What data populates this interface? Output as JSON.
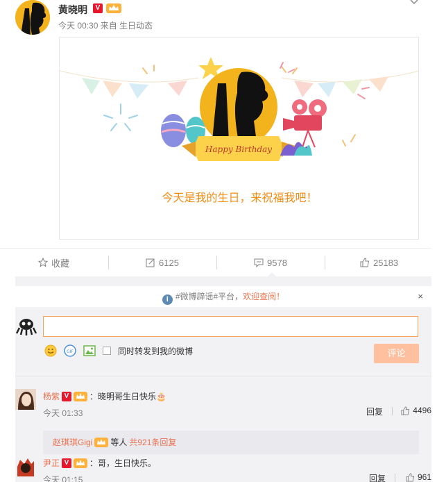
{
  "author": {
    "name": "黄晓明",
    "verified": "V",
    "meta": "今天 00:30 来自 生日动态"
  },
  "card": {
    "banner_text": "Happy Birthday",
    "message": "今天是我的生日，来祝福我吧！"
  },
  "actions": {
    "favorite": "收藏",
    "repost": "6125",
    "comment": "9578",
    "like": "25183"
  },
  "notice": {
    "prefix": "#微博辟谣#平台，",
    "link": "欢迎查阅！",
    "close": "×"
  },
  "composer": {
    "sync_label": "同时转发到我的微博",
    "post_button": "评论",
    "input_value": ""
  },
  "comments": [
    {
      "user": "杨紫",
      "verified": "V",
      "text": "：晓明哥生日快乐🎂",
      "time": "今天 01:33",
      "reply": "回复",
      "likes": "4496",
      "sub": {
        "names": "赵琪琪Gigi",
        "suffix": "等人",
        "count": "共921条回复"
      }
    },
    {
      "user": "尹正",
      "verified": "V",
      "text": "：哥，生日快乐。",
      "time": "今天 01:15",
      "reply": "回复",
      "likes": "961"
    }
  ],
  "colors": {
    "accent_orange": "#eb7350",
    "brand_yellow": "#f2b31c",
    "verified_red": "#e6162d",
    "message_orange": "#f08d15"
  }
}
